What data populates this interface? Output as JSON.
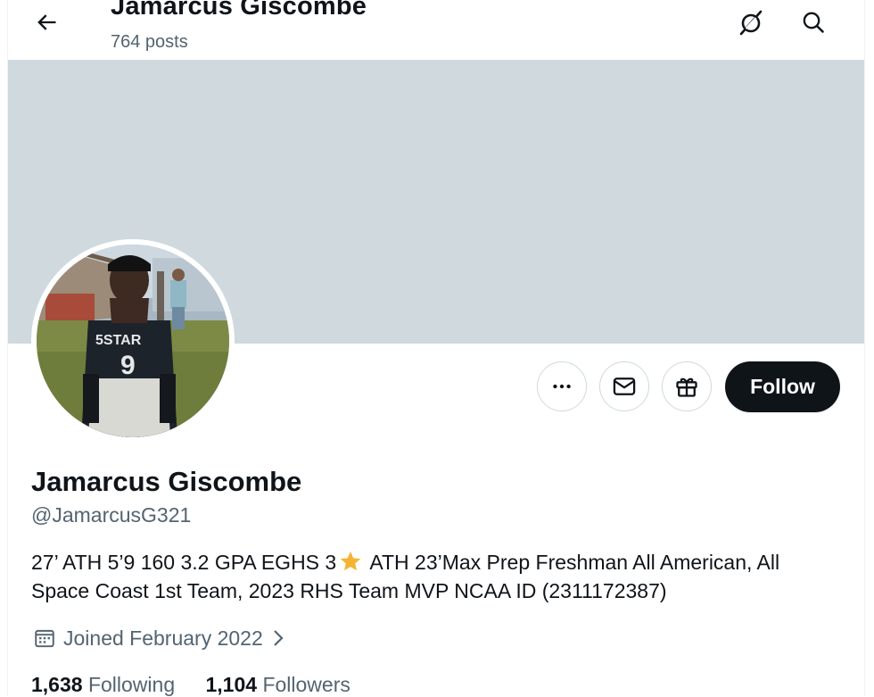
{
  "header": {
    "title": "Jamarcus Giscombe",
    "posts_count": "764 posts",
    "back_icon": "arrow-left-icon",
    "grok_icon": "grok-icon",
    "search_icon": "search-icon"
  },
  "profile": {
    "name": "Jamarcus Giscombe",
    "handle": "@JamarcusG321",
    "bio_part1": "27’ ATH 5’9 160 3.2 GPA EGHS 3",
    "bio_part2": " ATH 23’Max Prep Freshman All American, All Space Coast 1st Team, 2023 RHS Team MVP NCAA ID (2311172387)",
    "joined": "Joined February 2022",
    "following_count": "1,638",
    "following_label": "Following",
    "followers_count": "1,104",
    "followers_label": "Followers"
  },
  "actions": {
    "more_icon": "more-icon",
    "message_icon": "mail-icon",
    "gift_icon": "gift-icon",
    "follow_label": "Follow"
  },
  "jersey": {
    "brand_text": "5STAR",
    "number_text": "9"
  },
  "colors": {
    "banner": "#cfd9de",
    "text_primary": "#0f1419",
    "text_secondary": "#536471",
    "follow_bg": "#0f1419",
    "star": "#f5b335"
  }
}
